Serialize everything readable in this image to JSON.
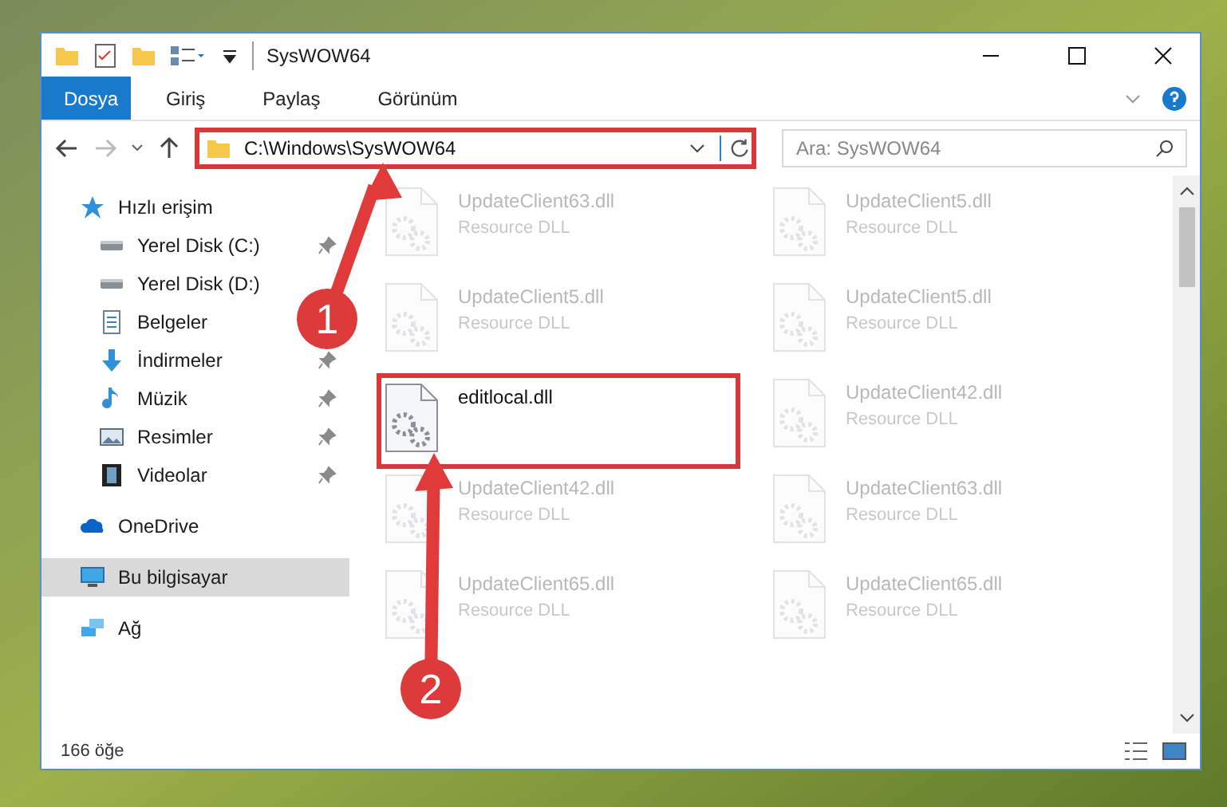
{
  "window": {
    "title": "SysWOW64"
  },
  "ribbon_tabs": [
    {
      "label": "Dosya",
      "selected": true
    },
    {
      "label": "Giriş",
      "selected": false
    },
    {
      "label": "Paylaş",
      "selected": false
    },
    {
      "label": "Görünüm",
      "selected": false
    }
  ],
  "address_bar": {
    "path": "C:\\Windows\\SysWOW64",
    "highlighted": true
  },
  "search": {
    "placeholder": "Ara: SysWOW64"
  },
  "sidebar": {
    "items": [
      {
        "label": "Hızlı erişim",
        "kind": "star",
        "selected": false,
        "children": [
          {
            "label": "Yerel Disk (C:)",
            "kind": "drive",
            "pinned": true,
            "selected": false
          },
          {
            "label": "Yerel Disk (D:)",
            "kind": "drive",
            "selected": false
          },
          {
            "label": "Belgeler",
            "kind": "document",
            "selected": false
          },
          {
            "label": "İndirmeler",
            "kind": "download",
            "pinned": true,
            "selected": false
          },
          {
            "label": "Müzik",
            "kind": "music",
            "pinned": true,
            "selected": false
          },
          {
            "label": "Resimler",
            "kind": "pictures",
            "pinned": true,
            "selected": false
          },
          {
            "label": "Videolar",
            "kind": "video",
            "pinned": true,
            "selected": false
          }
        ]
      },
      {
        "label": "OneDrive",
        "kind": "cloud",
        "selected": false
      },
      {
        "label": "Bu bilgisayar",
        "kind": "computer",
        "selected": true
      },
      {
        "label": "Ağ",
        "kind": "network",
        "selected": false
      }
    ]
  },
  "files": [
    {
      "name": "UpdateClient63.dll",
      "type": "Resource DLL",
      "highlighted": false
    },
    {
      "name": "UpdateClient5.dll",
      "type": "Resource DLL",
      "highlighted": false
    },
    {
      "name": "UpdateClient5.dll",
      "type": "Resource DLL",
      "highlighted": false
    },
    {
      "name": "UpdateClient5.dll",
      "type": "Resource DLL",
      "highlighted": false
    },
    {
      "name": "editlocal.dll",
      "highlighted": true
    },
    {
      "name": "UpdateClient42.dll",
      "type": "Resource DLL",
      "highlighted": false
    },
    {
      "name": "UpdateClient42.dll",
      "type": "Resource DLL",
      "highlighted": false
    },
    {
      "name": "UpdateClient63.dll",
      "type": "Resource DLL",
      "highlighted": false
    },
    {
      "name": "UpdateClient65.dll",
      "type": "Resource DLL",
      "highlighted": false
    },
    {
      "name": "UpdateClient65.dll",
      "type": "Resource DLL",
      "highlighted": false
    }
  ],
  "status_bar": {
    "item_count": "166 öğe"
  },
  "annotations": [
    {
      "number": "1"
    },
    {
      "number": "2"
    }
  ]
}
